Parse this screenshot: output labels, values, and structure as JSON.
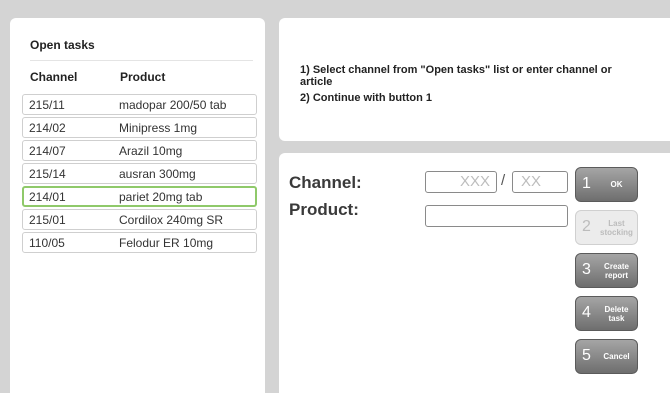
{
  "open_tasks": {
    "title": "Open tasks",
    "columns": [
      "Channel",
      "Product"
    ],
    "rows": [
      {
        "channel": "215/11",
        "product": "madopar 200/50 tab"
      },
      {
        "channel": "214/02",
        "product": "Minipress 1mg"
      },
      {
        "channel": "214/07",
        "product": "Arazil 10mg"
      },
      {
        "channel": "215/14",
        "product": "ausran 300mg"
      },
      {
        "channel": "214/01",
        "product": "pariet 20mg tab"
      },
      {
        "channel": "215/01",
        "product": "Cordilox 240mg SR"
      },
      {
        "channel": "110/05",
        "product": "Felodur ER 10mg"
      }
    ],
    "selected_index": 4
  },
  "instructions": {
    "line1": "1) Select channel from \"Open tasks\" list or enter channel or article",
    "line2": "2) Continue with button 1"
  },
  "form": {
    "channel_label": "Channel:",
    "product_label": "Product:",
    "channel_part1_placeholder": "XXX",
    "separator": "/",
    "channel_part2_placeholder": "XX",
    "product_value": ""
  },
  "buttons": [
    {
      "number": "1",
      "label": "OK",
      "enabled": true
    },
    {
      "number": "2",
      "label": "Last stocking",
      "enabled": false
    },
    {
      "number": "3",
      "label": "Create report",
      "enabled": true
    },
    {
      "number": "4",
      "label": "Delete task",
      "enabled": true
    },
    {
      "number": "5",
      "label": "Cancel",
      "enabled": true
    }
  ],
  "colors": {
    "background": "#d4d4d4",
    "selected_row_border": "#8fc96a",
    "button_gradient_top": "#a5a5a5",
    "button_gradient_bottom": "#6e6e6e"
  }
}
